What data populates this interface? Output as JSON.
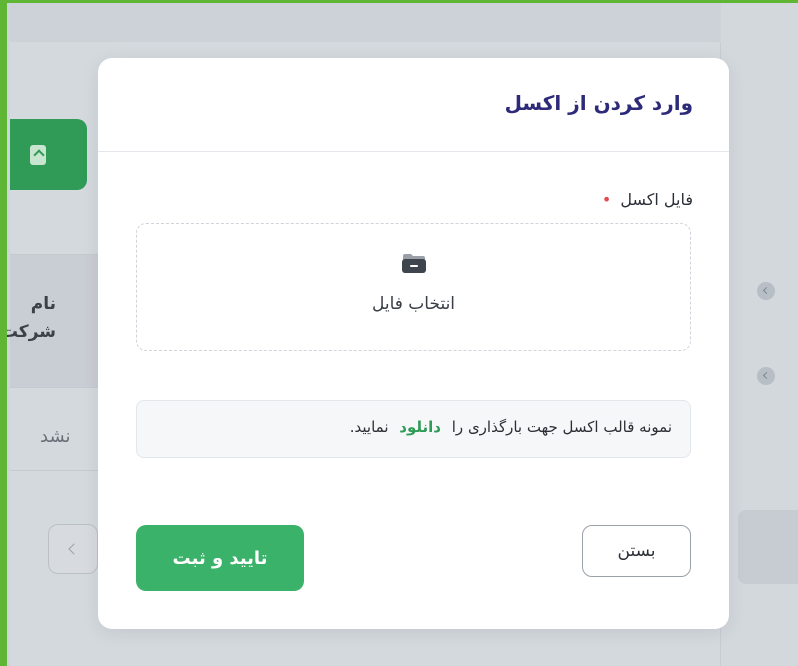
{
  "background": {
    "column_header_line1": "نام",
    "column_header_line2": "شرکت",
    "cell_text": "نشد"
  },
  "modal": {
    "title": "وارد کردن از اکسل",
    "file_field_label": "فایل اکسل",
    "required_marker": "•",
    "dropzone_label": "انتخاب فایل",
    "template_prefix": "نمونه قالب اکسل جهت بارگذاری را",
    "template_link": "دانلود",
    "template_suffix": "نمایید.",
    "close_label": "بستن",
    "confirm_label": "تایید و ثبت"
  },
  "colors": {
    "accent_green": "#3bb26a",
    "title_color": "#2d2a7a",
    "required_red": "#e5484d"
  }
}
